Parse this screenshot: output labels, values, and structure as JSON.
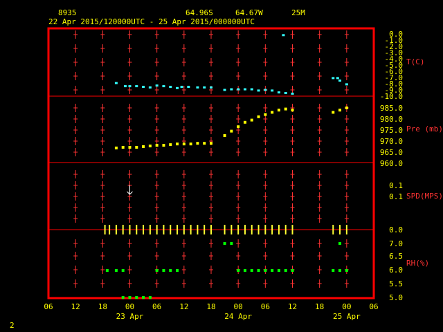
{
  "header": {
    "station": "8935",
    "lat": "64.96S",
    "lon": "64.67W",
    "elev": "25M",
    "period": "22 Apr 2015/120000UTC - 25 Apr 2015/000000UTC"
  },
  "footer": {
    "page_number": "2"
  },
  "colors": {
    "frame": "#ff0000",
    "text": "#ffff00",
    "labels": "#ff3333",
    "temperature": "#33ffff",
    "pressure": "#ffff00",
    "wind": "#ffff33",
    "rh": "#00ff00",
    "arrow": "#ffffff",
    "background": "#000000"
  },
  "chart_data": {
    "type": "scatter",
    "x_axis": {
      "unit": "hours since 22 Apr 2015 06 UTC",
      "ticks": [
        "06",
        "12",
        "18",
        "00",
        "06",
        "12",
        "18",
        "00",
        "06",
        "12",
        "18",
        "00",
        "06"
      ],
      "date_labels": [
        {
          "label": "23 Apr",
          "x": 18
        },
        {
          "label": "24 Apr",
          "x": 42
        },
        {
          "label": "25 Apr",
          "x": 66
        }
      ],
      "range": [
        0,
        72
      ]
    },
    "panels": [
      {
        "name": "T(C)",
        "ticks": [
          "0.0",
          "-1.0",
          "-2.0",
          "-3.0",
          "-4.0",
          "-5.0",
          "-6.0",
          "-7.0",
          "-8.0",
          "-9.0",
          "-10.0"
        ],
        "range": [
          0,
          -10
        ],
        "points": [
          [
            15,
            -7.9
          ],
          [
            17,
            -8.4
          ],
          [
            18,
            -8.4
          ],
          [
            19.5,
            -8.4
          ],
          [
            21,
            -8.5
          ],
          [
            22.5,
            -8.6
          ],
          [
            24,
            -8.3
          ],
          [
            25.5,
            -8.4
          ],
          [
            27,
            -8.5
          ],
          [
            28.5,
            -8.7
          ],
          [
            29.5,
            -8.5
          ],
          [
            31,
            -8.5
          ],
          [
            33,
            -8.6
          ],
          [
            34.5,
            -8.6
          ],
          [
            36,
            -8.6
          ],
          [
            39,
            -9.0
          ],
          [
            40.5,
            -8.9
          ],
          [
            42,
            -8.9
          ],
          [
            43.5,
            -8.9
          ],
          [
            45,
            -8.9
          ],
          [
            46.5,
            -9.1
          ],
          [
            48,
            -9.0
          ],
          [
            49.5,
            -9.1
          ],
          [
            51,
            -9.4
          ],
          [
            52.5,
            -9.5
          ],
          [
            54,
            -9.6
          ],
          [
            52,
            -0.2
          ],
          [
            63,
            -7.1
          ],
          [
            64,
            -7.1
          ],
          [
            64.5,
            -7.5
          ],
          [
            66,
            -8.1
          ]
        ]
      },
      {
        "name": "Pre (mb)",
        "ticks": [
          "985.0",
          "980.0",
          "975.0",
          "970.0",
          "965.0",
          "960.0"
        ],
        "range": [
          960,
          987
        ],
        "points": [
          [
            15,
            966.9
          ],
          [
            16.5,
            967.2
          ],
          [
            18,
            967.2
          ],
          [
            19.5,
            967.2
          ],
          [
            21,
            967.5
          ],
          [
            22.5,
            967.8
          ],
          [
            24,
            968.1
          ],
          [
            25.5,
            968.1
          ],
          [
            27,
            968.4
          ],
          [
            28.5,
            968.7
          ],
          [
            30,
            968.7
          ],
          [
            31.5,
            968.7
          ],
          [
            33,
            969
          ],
          [
            34.5,
            969
          ],
          [
            36,
            969
          ],
          [
            39,
            972.5
          ],
          [
            40.5,
            974.5
          ],
          [
            42,
            976.5
          ],
          [
            43.5,
            978.5
          ],
          [
            45,
            979.5
          ],
          [
            46.5,
            981
          ],
          [
            48,
            982
          ],
          [
            49.5,
            983
          ],
          [
            51,
            984
          ],
          [
            52.5,
            984.5
          ],
          [
            54,
            984
          ],
          [
            63,
            983
          ],
          [
            64.5,
            984
          ],
          [
            66,
            985
          ]
        ]
      },
      {
        "name": "SPD(MPS)",
        "ticks": [
          "0.1",
          "0.1",
          "0.0"
        ],
        "arrow": {
          "x": 18
        }
      },
      {
        "name": "Wind barbs",
        "x": [
          12.5,
          13.5,
          15,
          16.5,
          18,
          19.5,
          21,
          22.5,
          24,
          25.5,
          27,
          28.5,
          30,
          31.5,
          33,
          34.5,
          36,
          39,
          40.5,
          42,
          43.5,
          45,
          46.5,
          48,
          49.5,
          51,
          52.5,
          54,
          63,
          64.5,
          66
        ]
      },
      {
        "name": "RH(%)",
        "ticks": [
          "7.0",
          "6.5",
          "6.0",
          "5.5",
          "5.0"
        ],
        "range": [
          5,
          7.2
        ],
        "points": [
          [
            13,
            6.0
          ],
          [
            15,
            6.0
          ],
          [
            16.5,
            6.0
          ],
          [
            24,
            6.0
          ],
          [
            25.5,
            6.0
          ],
          [
            27,
            6.0
          ],
          [
            28.5,
            6.0
          ],
          [
            39,
            7.0
          ],
          [
            40.5,
            7.0
          ],
          [
            42,
            6.0
          ],
          [
            43.5,
            6.0
          ],
          [
            45,
            6.0
          ],
          [
            46.5,
            6.0
          ],
          [
            48,
            6.0
          ],
          [
            49.5,
            6.0
          ],
          [
            51,
            6.0
          ],
          [
            52.5,
            6.0
          ],
          [
            54,
            6.0
          ],
          [
            63,
            6.0
          ],
          [
            64.5,
            6.0
          ],
          [
            66,
            6.0
          ],
          [
            64.5,
            7.0
          ],
          [
            16.5,
            5.0
          ],
          [
            18,
            5.0
          ],
          [
            19.5,
            5.0
          ],
          [
            21,
            5.0
          ],
          [
            22.5,
            5.0
          ]
        ]
      }
    ]
  }
}
